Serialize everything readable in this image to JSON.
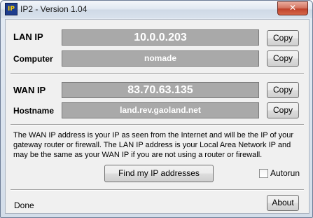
{
  "window": {
    "title": "IP2 - Version 1.04",
    "app_icon_text": "IP",
    "close_glyph": "✕"
  },
  "lan": {
    "ip_label": "LAN IP",
    "ip_value": "10.0.0.203",
    "computer_label": "Computer",
    "computer_value": "nomade"
  },
  "wan": {
    "ip_label": "WAN IP",
    "ip_value": "83.70.63.135",
    "hostname_label": "Hostname",
    "hostname_value": "land.rev.gaoland.net"
  },
  "buttons": {
    "copy_label": "Copy",
    "find_label": "Find my IP addresses",
    "about_label": "About"
  },
  "description": "The WAN IP address is your IP as seen from the Internet and will be the IP of your gateway router or firewall. The LAN IP address is your Local Area Network IP and may be the same as your WAN IP if you are not using a router or firewall.",
  "autorun": {
    "label": "Autorun",
    "checked": false
  },
  "status_text": "Done",
  "colors": {
    "field_bg": "#a9a9a9",
    "close_red": "#c0432c",
    "title_gradient": "#dfe7f1"
  }
}
